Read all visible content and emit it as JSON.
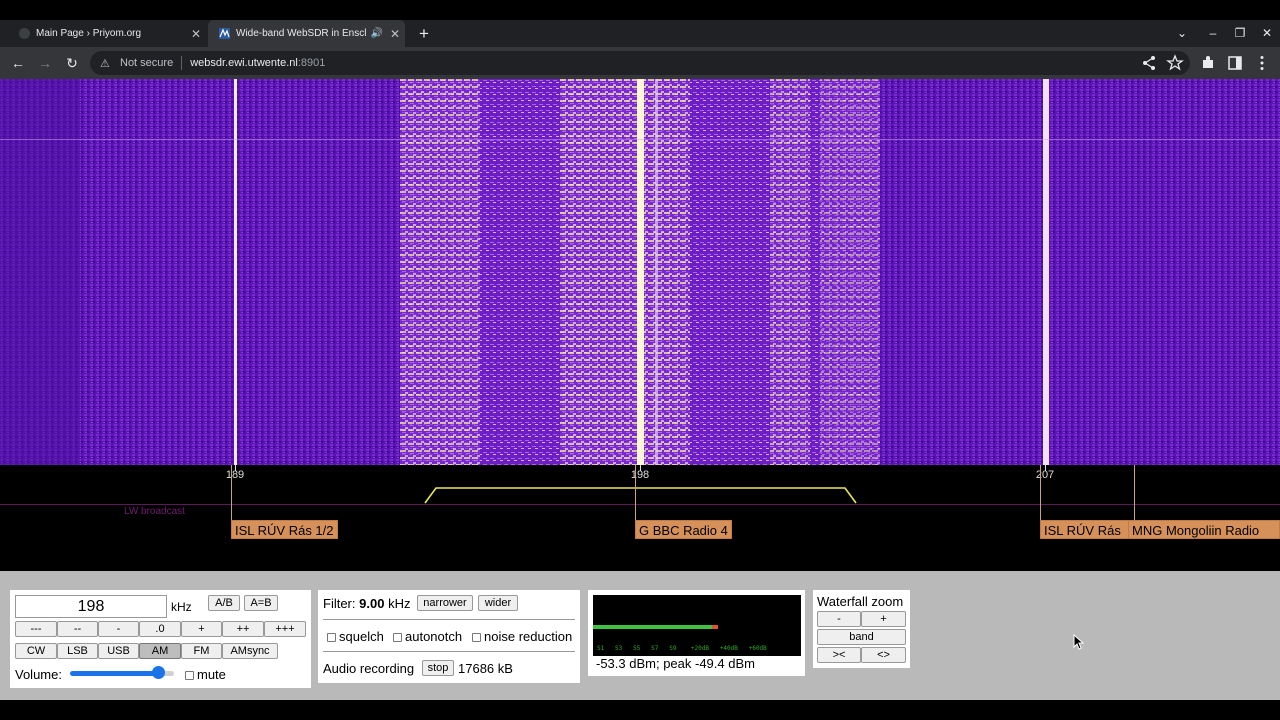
{
  "browser": {
    "tabs": [
      {
        "title": "Main Page › Priyom.org",
        "close": "✕"
      },
      {
        "title": "Wide-band WebSDR in Enscl",
        "close": "✕",
        "audio": "🔊"
      }
    ],
    "new_tab": "+",
    "nav": {
      "back": "←",
      "forward": "→",
      "reload": "↻"
    },
    "omnibox": {
      "security_icon": "⚠",
      "security_text": "Not secure",
      "host": "websdr.ewi.utwente.nl",
      "port": ":8901"
    },
    "window_controls": [
      "⌄",
      "–",
      "❐",
      "✕"
    ],
    "toolbar_icons": [
      "share-icon",
      "star-icon",
      "extensions-icon",
      "sidepanel-icon",
      "menu-icon"
    ]
  },
  "scale": {
    "ticks": [
      "189",
      "198",
      "207"
    ],
    "band_label": "LW broadcast"
  },
  "stations": [
    {
      "label": "ISL RÚV Rás 1/2"
    },
    {
      "label": "G BBC Radio 4"
    },
    {
      "label": "ISL RÚV Rás"
    },
    {
      "label": "MNG Mongoliin Radio"
    }
  ],
  "tuning": {
    "frequency": "198",
    "unit": "kHz",
    "ab_label": "A/B",
    "aeqb_label": "A=B",
    "step_buttons": [
      "---",
      "--",
      "-",
      ".0",
      "+",
      "++",
      "+++"
    ],
    "modes": [
      "CW",
      "LSB",
      "USB",
      "AM",
      "FM",
      "AMsync"
    ],
    "selected_mode": "AM",
    "volume_label": "Volume:",
    "volume_level": 0.85,
    "mute_label": "mute"
  },
  "filter": {
    "label": "Filter:",
    "value": "9.00",
    "unit": "kHz",
    "narrower": "narrower",
    "wider": "wider",
    "squelch": "squelch",
    "autonotch": "autonotch",
    "noise_reduction": "noise reduction",
    "recording_label": "Audio recording",
    "stop": "stop",
    "recorded_size": "17686 kB"
  },
  "smeter": {
    "reading": "-53.3 dBm; peak  -49.4 dBm",
    "scale": "S1   S3   S5   S7   S9    +20dB   +40dB   +60dB",
    "level": 0.57,
    "peak": 0.6
  },
  "zoom": {
    "title": "Waterfall zoom",
    "minus": "-",
    "plus": "+",
    "band": "band",
    "zoom_in": "><",
    "zoom_out": "<>"
  },
  "colors": {
    "waterfall_base": "#5a12b0",
    "station_label": "#d6915a",
    "passband": "#e8e85a"
  }
}
